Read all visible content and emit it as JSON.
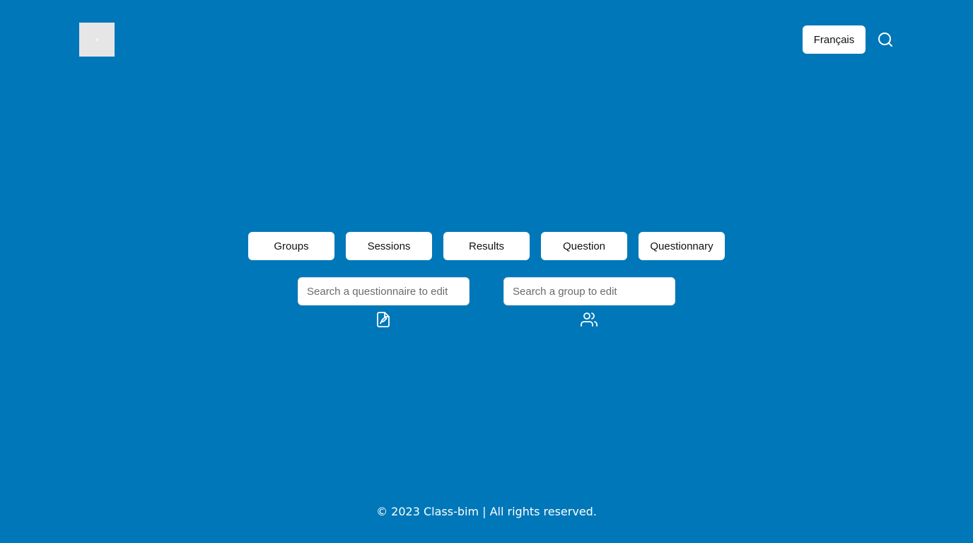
{
  "header": {
    "logo_icon": "app-logo",
    "language_button_label": "Français",
    "search_icon": "search-icon"
  },
  "nav": {
    "buttons": [
      {
        "label": "Groups"
      },
      {
        "label": "Sessions"
      },
      {
        "label": "Results"
      },
      {
        "label": "Question"
      },
      {
        "label": "Questionnary"
      }
    ]
  },
  "search": {
    "questionnaire": {
      "placeholder": "Search a questionnaire to edit",
      "value": "",
      "icon": "file-edit-icon"
    },
    "group": {
      "placeholder": "Search a group to edit",
      "value": "",
      "icon": "users-icon"
    }
  },
  "footer": {
    "text": "© 2023 Class-bim | All rights reserved."
  },
  "colors": {
    "background": "#0077b8",
    "button_bg": "#ffffff",
    "text_light": "#ffffff"
  }
}
